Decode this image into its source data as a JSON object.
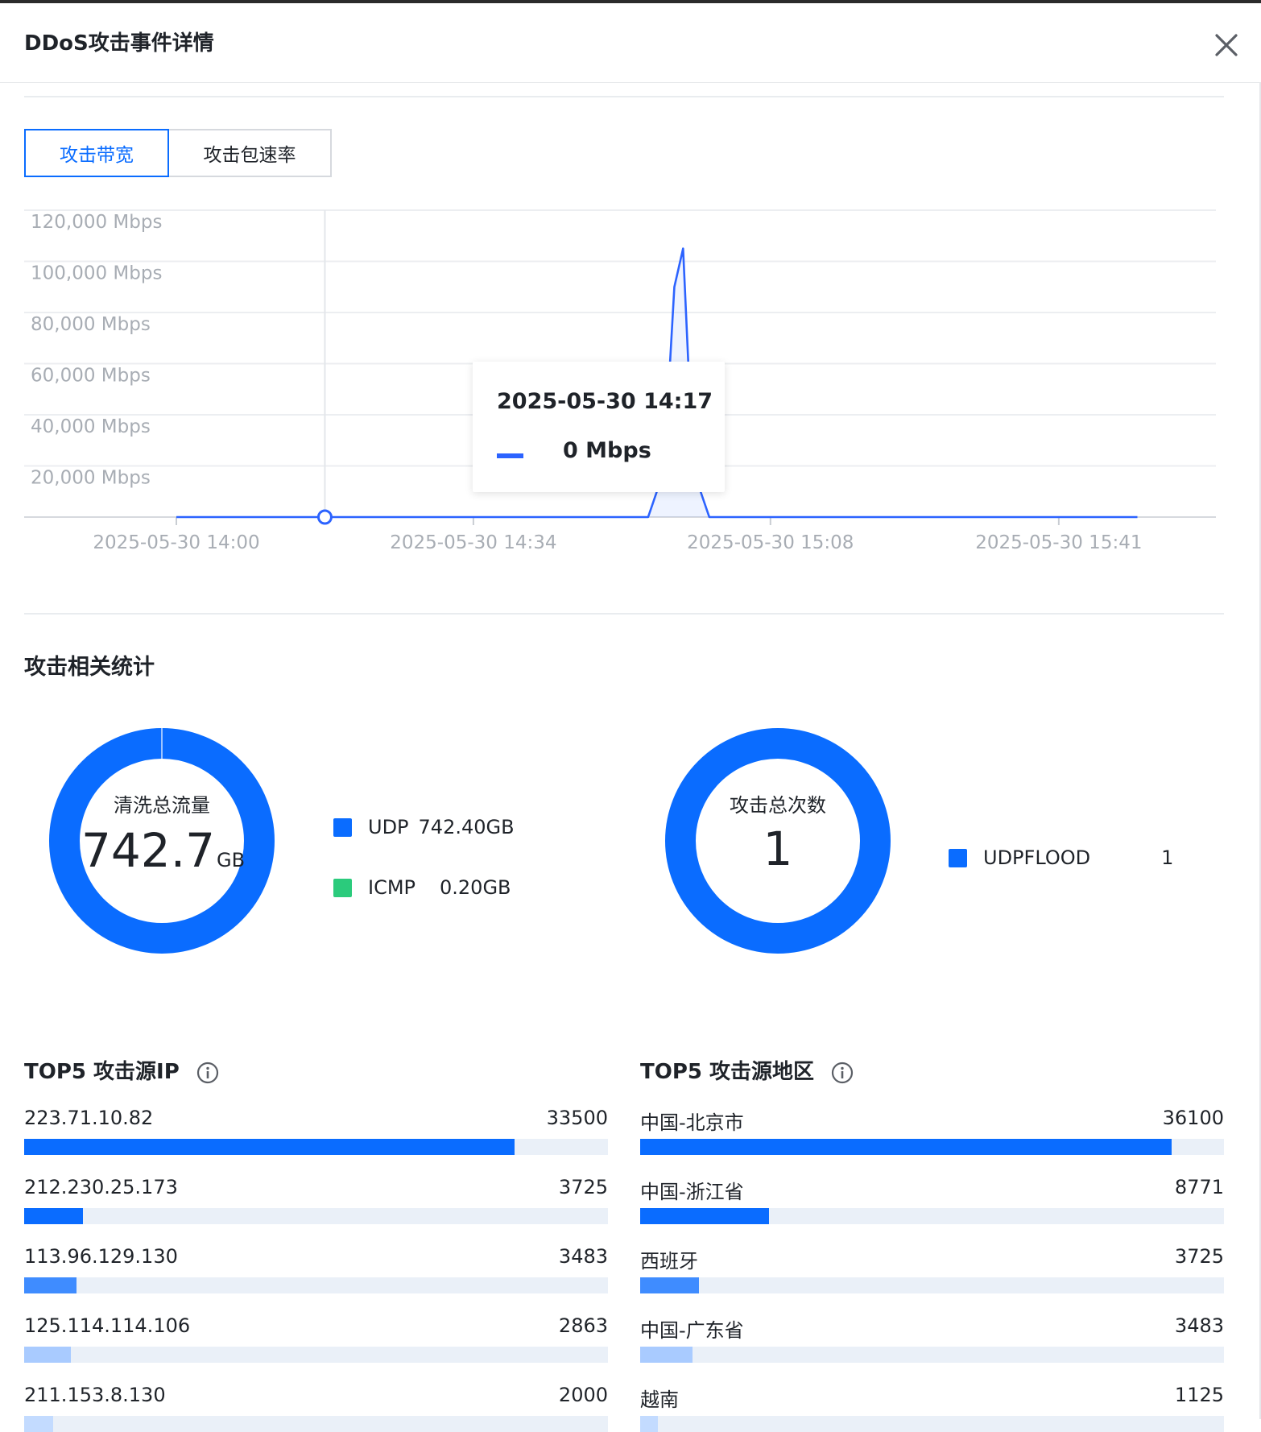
{
  "dialog": {
    "title": "DDoS攻击事件详情"
  },
  "tabs": [
    {
      "label": "攻击带宽",
      "active": true
    },
    {
      "label": "攻击包速率",
      "active": false
    }
  ],
  "chart_data": {
    "type": "line",
    "series": [
      {
        "color": "#2c63ff",
        "points": [
          {
            "x": "2025-05-30 14:00",
            "y": 0
          },
          {
            "x": "2025-05-30 14:17",
            "y": 0
          },
          {
            "x": "2025-05-30 14:34",
            "y": 0
          },
          {
            "x": "2025-05-30 14:54",
            "y": 0
          },
          {
            "x": "2025-05-30 14:55",
            "y": 10000
          },
          {
            "x": "2025-05-30 14:56",
            "y": 30000
          },
          {
            "x": "2025-05-30 14:57",
            "y": 90000
          },
          {
            "x": "2025-05-30 14:58",
            "y": 105000
          },
          {
            "x": "2025-05-30 14:59",
            "y": 30000
          },
          {
            "x": "2025-05-30 15:00",
            "y": 10000
          },
          {
            "x": "2025-05-30 15:01",
            "y": 0
          },
          {
            "x": "2025-05-30 15:08",
            "y": 0
          },
          {
            "x": "2025-05-30 15:41",
            "y": 0
          },
          {
            "x": "2025-05-30 15:50",
            "y": 0
          }
        ]
      }
    ],
    "y_ticks": [
      "120,000 Mbps",
      "100,000 Mbps",
      "80,000 Mbps",
      "60,000 Mbps",
      "40,000 Mbps",
      "20,000 Mbps"
    ],
    "x_ticks": [
      "2025-05-30 14:00",
      "2025-05-30 14:34",
      "2025-05-30 15:08",
      "2025-05-30 15:41"
    ],
    "ylim": [
      0,
      120000
    ],
    "grid": true,
    "tooltip": {
      "time": "2025-05-30 14:17",
      "value": "0 Mbps"
    }
  },
  "stats": {
    "title": "攻击相关统计",
    "traffic": {
      "label": "清洗总流量",
      "value": "742.7",
      "unit": "GB",
      "legend": [
        {
          "name": "UDP",
          "value": "742.40GB",
          "color": "#0a6cff"
        },
        {
          "name": "ICMP",
          "value": "0.20GB",
          "color": "#2bcb7c"
        }
      ]
    },
    "count": {
      "label": "攻击总次数",
      "value": "1",
      "legend": [
        {
          "name": "UDPFLOOD",
          "value": "1",
          "color": "#0a6cff"
        }
      ]
    }
  },
  "top_ip": {
    "title": "TOP5 攻击源IP",
    "max": 33500,
    "rows": [
      {
        "label": "223.71.10.82",
        "value": "33500",
        "fraction": 0.84,
        "color": "#0a6cff"
      },
      {
        "label": "212.230.25.173",
        "value": "3725",
        "fraction": 0.1,
        "color": "#0a6cff"
      },
      {
        "label": "113.96.129.130",
        "value": "3483",
        "fraction": 0.09,
        "color": "#3f8cff"
      },
      {
        "label": "125.114.114.106",
        "value": "2863",
        "fraction": 0.08,
        "color": "#a9cbff"
      },
      {
        "label": "211.153.8.130",
        "value": "2000",
        "fraction": 0.05,
        "color": "#c3dbff"
      }
    ]
  },
  "top_region": {
    "title": "TOP5 攻击源地区",
    "rows": [
      {
        "label": "中国-北京市",
        "value": "36100",
        "fraction": 0.91,
        "color": "#0a6cff"
      },
      {
        "label": "中国-浙江省",
        "value": "8771",
        "fraction": 0.22,
        "color": "#0a6cff"
      },
      {
        "label": "西班牙",
        "value": "3725",
        "fraction": 0.1,
        "color": "#3f8cff"
      },
      {
        "label": "中国-广东省",
        "value": "3483",
        "fraction": 0.09,
        "color": "#a9cbff"
      },
      {
        "label": "越南",
        "value": "1125",
        "fraction": 0.03,
        "color": "#c3dbff"
      }
    ]
  }
}
